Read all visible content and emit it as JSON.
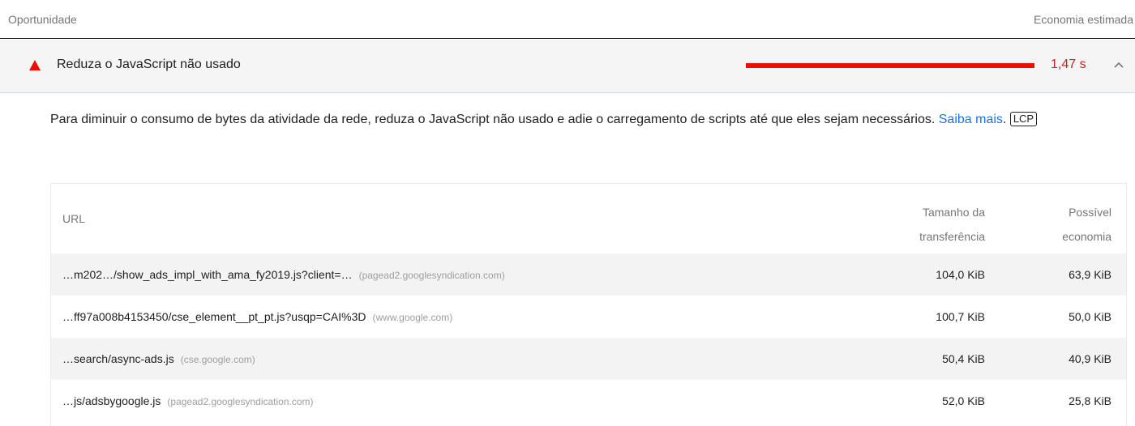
{
  "header": {
    "left_label": "Oportunidade",
    "right_label": "Economia estimada"
  },
  "audit": {
    "title": "Reduza o JavaScript não usado",
    "value": "1,47 s",
    "savings_fraction": 1.0,
    "status_color": "#eb0f00",
    "icon": "fail-triangle-icon",
    "expand_icon": "chevron-up-icon"
  },
  "description": {
    "text": "Para diminuir o consumo de bytes da atividade da rede, reduza o JavaScript não usado e adie o carregamento de scripts até que eles sejam necessários.",
    "link_text": "Saiba mais",
    "after_link": ".",
    "badge": "LCP",
    "link_color": "#1a73e8"
  },
  "table": {
    "columns": {
      "url": "URL",
      "size_line1": "Tamanho da",
      "size_line2": "transferência",
      "save_line1": "Possível",
      "save_line2": "economia"
    },
    "rows": [
      {
        "url": "…m202…/show_ads_impl_with_ama_fy2019.js?client=…",
        "host": "(pagead2.googlesyndication.com)",
        "size": "104,0 KiB",
        "savings": "63,9 KiB"
      },
      {
        "url": "…ff97a008b4153450/cse_element__pt_pt.js?usqp=CAI%3D",
        "host": "(www.google.com)",
        "size": "100,7 KiB",
        "savings": "50,0 KiB"
      },
      {
        "url": "…search/async-ads.js",
        "host": "(cse.google.com)",
        "size": "50,4 KiB",
        "savings": "40,9 KiB"
      },
      {
        "url": "…js/adsbygoogle.js",
        "host": "(pagead2.googlesyndication.com)",
        "size": "52,0 KiB",
        "savings": "25,8 KiB"
      }
    ]
  }
}
